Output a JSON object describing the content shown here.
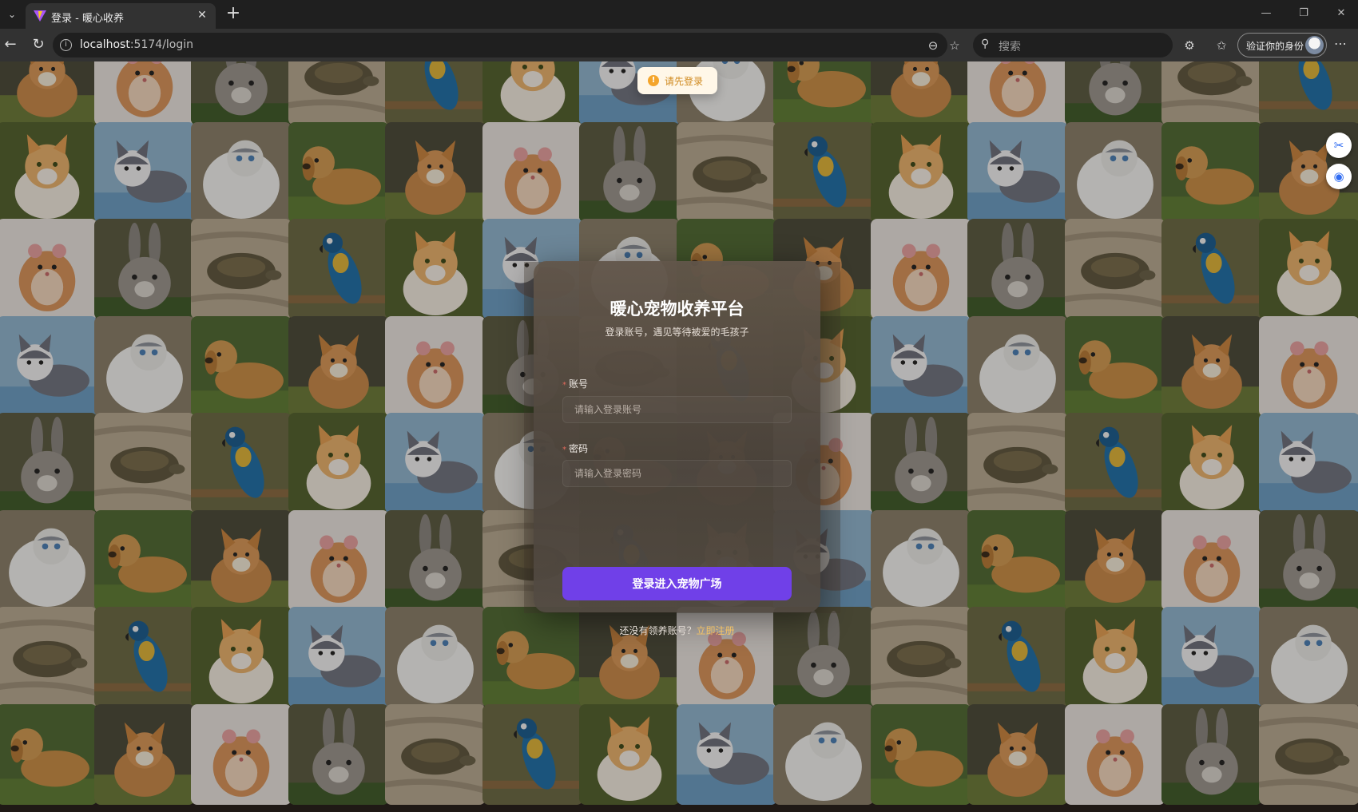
{
  "browser": {
    "tab_title": "登录 - 暖心收养",
    "url_host": "localhost",
    "url_rest": ":5174/login",
    "search_placeholder": "搜索",
    "profile_label": "验证你的身份"
  },
  "toast": {
    "message": "请先登录",
    "icon": "warning-icon"
  },
  "login": {
    "title": "暖心宠物收养平台",
    "subtitle": "登录账号，遇见等待被爱的毛孩子",
    "account_label": "账号",
    "account_placeholder": "请输入登录账号",
    "password_label": "密码",
    "password_placeholder": "请输入登录密码",
    "submit_label": "登录进入宠物广场",
    "register_prompt": "还没有领养账号？",
    "register_link": "立即注册"
  },
  "background": {
    "tile_sequence": [
      "corgi",
      "hamster",
      "rabbit",
      "tortoise",
      "parrot",
      "orange-cat",
      "gray-cat",
      "fluffy-cat",
      "golden-retriever"
    ]
  },
  "colors": {
    "primary": "#7040e8",
    "link": "#f3c265",
    "toast_bg": "#fff7e8",
    "toast_accent": "#f4a52b"
  }
}
